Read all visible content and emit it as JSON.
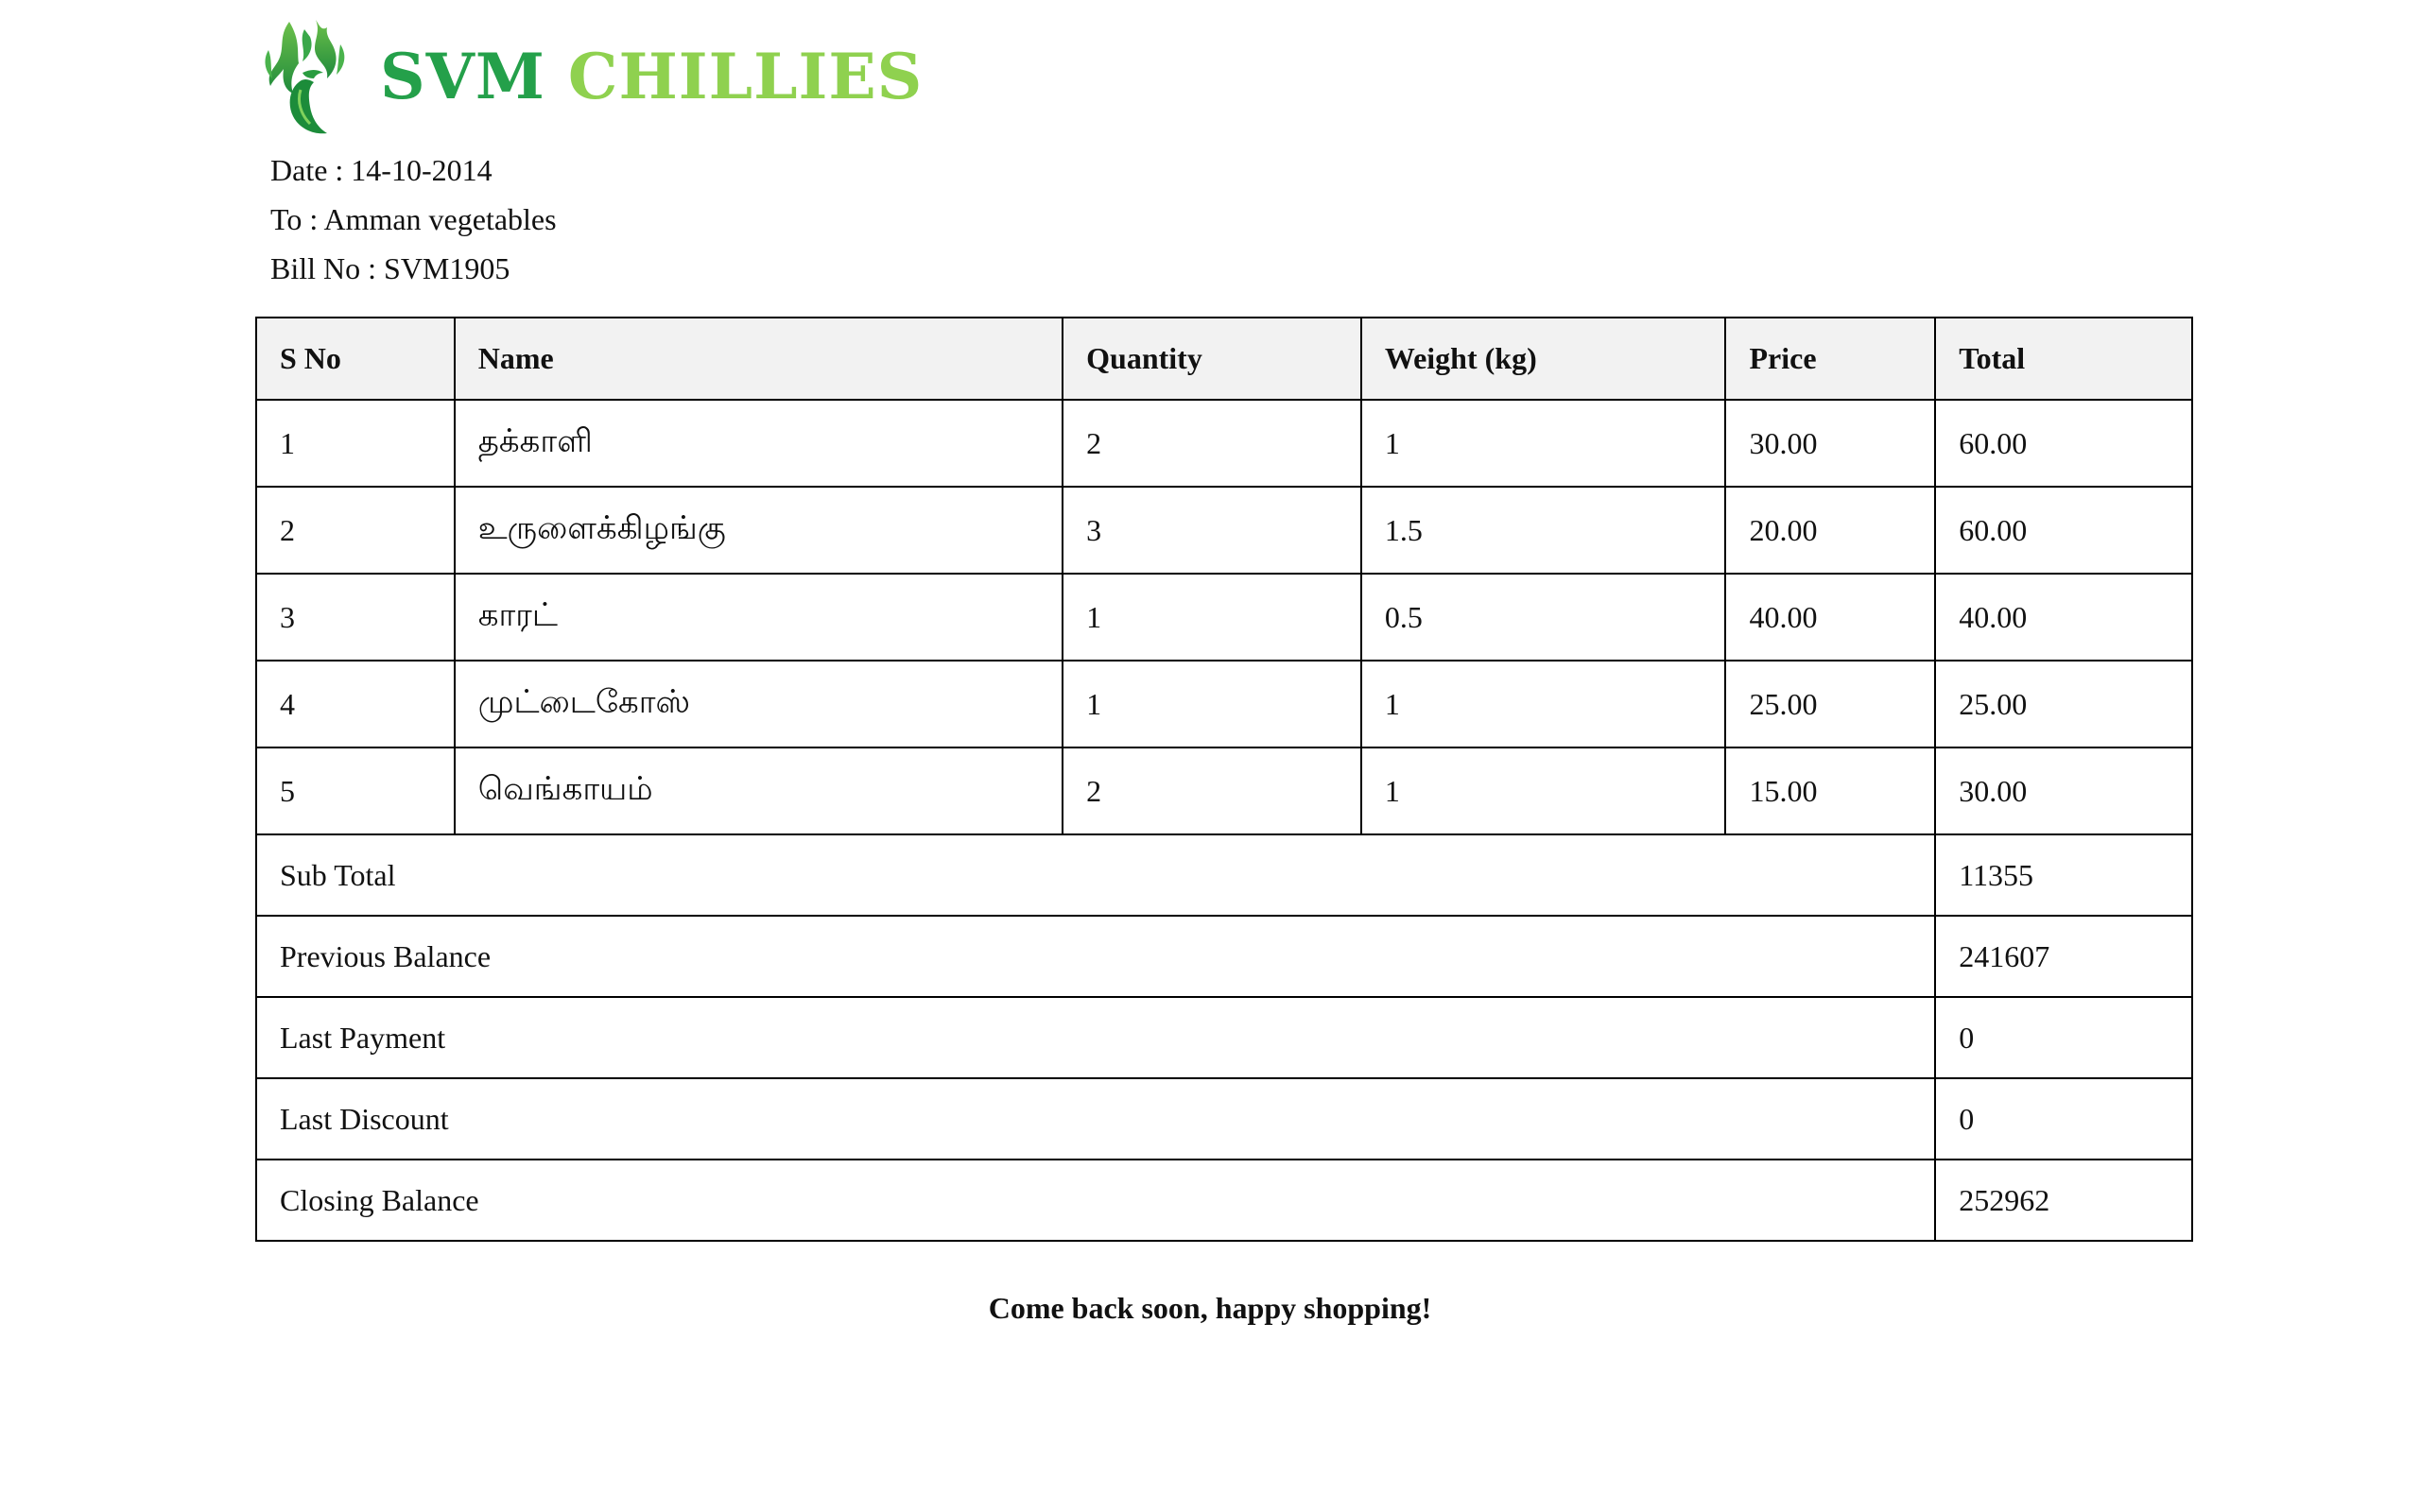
{
  "brand": {
    "name_part1": "SVM",
    "name_part2": "CHILLIES",
    "logo_icon": "chilli-flame-icon",
    "colors": {
      "dark_green": "#24a04a",
      "light_green": "#8fd14f"
    }
  },
  "bill": {
    "date_line": "Date : 14-10-2014",
    "to_line": "To : Amman vegetables",
    "bill_no_line": "Bill No : SVM1905"
  },
  "table": {
    "headers": [
      "S No",
      "Name",
      "Quantity",
      "Weight (kg)",
      "Price",
      "Total"
    ],
    "rows": [
      {
        "sno": "1",
        "name": "தக்காளி",
        "quantity": "2",
        "weight": "1",
        "price": "30.00",
        "total": "60.00"
      },
      {
        "sno": "2",
        "name": "உருளைக்கிழங்கு",
        "quantity": "3",
        "weight": "1.5",
        "price": "20.00",
        "total": "60.00"
      },
      {
        "sno": "3",
        "name": "காரட்",
        "quantity": "1",
        "weight": "0.5",
        "price": "40.00",
        "total": "40.00"
      },
      {
        "sno": "4",
        "name": "முட்டைகோஸ்",
        "quantity": "1",
        "weight": "1",
        "price": "25.00",
        "total": "25.00"
      },
      {
        "sno": "5",
        "name": "வெங்காயம்",
        "quantity": "2",
        "weight": "1",
        "price": "15.00",
        "total": "30.00"
      }
    ],
    "summary": [
      {
        "label": "Sub Total",
        "value": "11355"
      },
      {
        "label": "Previous Balance",
        "value": "241607"
      },
      {
        "label": "Last Payment",
        "value": "0"
      },
      {
        "label": "Last Discount",
        "value": "0"
      },
      {
        "label": "Closing Balance",
        "value": "252962"
      }
    ]
  },
  "footer": {
    "message": "Come back soon, happy shopping!"
  }
}
